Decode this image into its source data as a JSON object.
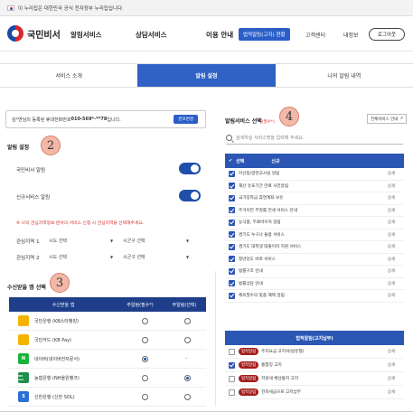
{
  "gov_banner": {
    "text": "이 누리집은 대한민국 공식 전자정부 누리집입니다."
  },
  "header": {
    "logo": "국민비서",
    "nav": [
      "알림서비스",
      "상담서비스",
      "이용 안내"
    ],
    "law_button": "법적알림(고지) 현황",
    "customer_center": "고객센터",
    "my_info": "내정보",
    "login": "로그아웃"
  },
  "tabs": [
    {
      "label": "서비스 소개",
      "active": false
    },
    {
      "label": "알림 설정",
      "active": true
    },
    {
      "label": "나의 알림 내역",
      "active": false
    }
  ],
  "notice": {
    "text_prefix": "김*연님의 등록된 휴대전화번호 ",
    "phone": "010-569*-**78",
    "text_suffix": " 입니다.",
    "change_button": "번호변경"
  },
  "settings": {
    "title": "알림 설정",
    "marker": "2",
    "rows": [
      {
        "label": "국민비서 알림",
        "on": true
      },
      {
        "label": "신규서비스 알림",
        "on": true
      }
    ],
    "warning": "※ 나의 관심지역정보 분야의 서비스 신청 시 관심지역을 선택해주세요.",
    "regions": [
      {
        "label": "관심지역 1",
        "city": "시도 선택",
        "district": "시군구 선택"
      },
      {
        "label": "관심지역 2",
        "city": "시도 선택",
        "district": "시군구 선택"
      }
    ]
  },
  "apps": {
    "title": "수신받을 앱 선택",
    "marker": "3",
    "headers": [
      "수신받을 앱",
      "주알림(필수*)",
      "부알림(선택)"
    ],
    "rows": [
      {
        "name": "국민은행 (KB스타뱅킹)",
        "icon_text": "",
        "icon_color": "#f3b400",
        "main": false,
        "sub": false,
        "sub_dash": false
      },
      {
        "name": "국민카드 (KB Pay)",
        "icon_text": "",
        "icon_color": "#f3b400",
        "main": false,
        "sub": false,
        "sub_dash": false
      },
      {
        "name": "네이버(네이버전자문서)",
        "icon_text": "N",
        "icon_color": "#19b339",
        "main": true,
        "sub": false,
        "sub_dash": true
      },
      {
        "name": "농협은행 (NH올원뱅크)",
        "icon_text": "NH one",
        "icon_color": "#1c8f4c",
        "main": false,
        "sub": true,
        "sub_dash": false
      },
      {
        "name": "신한은행 (신한 SOL)",
        "icon_text": "S",
        "icon_color": "#2c6fd6",
        "main": false,
        "sub": false,
        "sub_dash": false
      }
    ]
  },
  "services": {
    "title": "알림서비스 선택",
    "title_suffix": "(필수*)",
    "marker": "4",
    "guide_button": "전체서비스 안내",
    "search_placeholder": "검색하실 서비스명을 입력해 주세요.",
    "headers": [
      "선택",
      "신규"
    ],
    "detail_label": "상세",
    "rows": [
      "아산동/양천고사실 알림",
      "재산 유효기간 만료 사전알림",
      "국가장학금 휴면계좌 보유",
      "주거이전 부정률 전세 서비스 안내",
      "농식품, 무료바우처 알림",
      "경기도 누구나 돌봄 서비스",
      "경기도 대학생 대출이자 지원 서비스",
      "청년당도 바로 서비스",
      "법률구조 안내",
      "법률상담 안내",
      "체육필수의 맞춤 혜택 알림"
    ]
  },
  "legal": {
    "header": "법적알림(고지납부)",
    "badge": "법적알림",
    "detail_label": "상세",
    "rows": [
      {
        "text": "주차요금 고지서(방문형)",
        "checked": false
      },
      {
        "text": "통합징 고지",
        "checked": true
      },
      {
        "text": "지방세 체납통지 고지",
        "checked": false
      },
      {
        "text": "전자세금으로 고지납부",
        "checked": false
      }
    ]
  }
}
